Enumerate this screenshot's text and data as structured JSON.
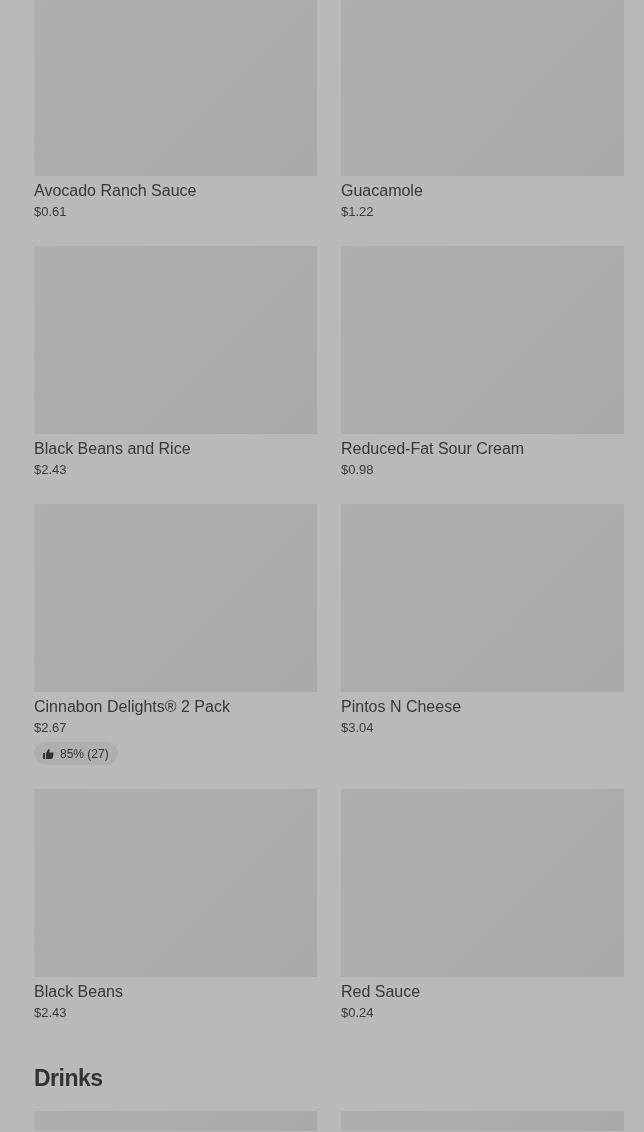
{
  "items": [
    {
      "name": "Avocado Ranch Sauce",
      "price": "$0.61"
    },
    {
      "name": "Guacamole",
      "price": "$1.22"
    },
    {
      "name": "Black Beans and Rice",
      "price": "$2.43"
    },
    {
      "name": "Reduced-Fat Sour Cream",
      "price": "$0.98"
    },
    {
      "name": "Cinnabon Delights® 2 Pack",
      "price": "$2.67",
      "rating": "85% (27)"
    },
    {
      "name": "Pintos N Cheese",
      "price": "$3.04"
    },
    {
      "name": "Black Beans",
      "price": "$2.43"
    },
    {
      "name": "Red Sauce",
      "price": "$0.24"
    }
  ],
  "sections": [
    {
      "title": "Drinks",
      "items": [
        {
          "kind": "placeholder"
        },
        {
          "kind": "placeholder"
        }
      ]
    }
  ]
}
